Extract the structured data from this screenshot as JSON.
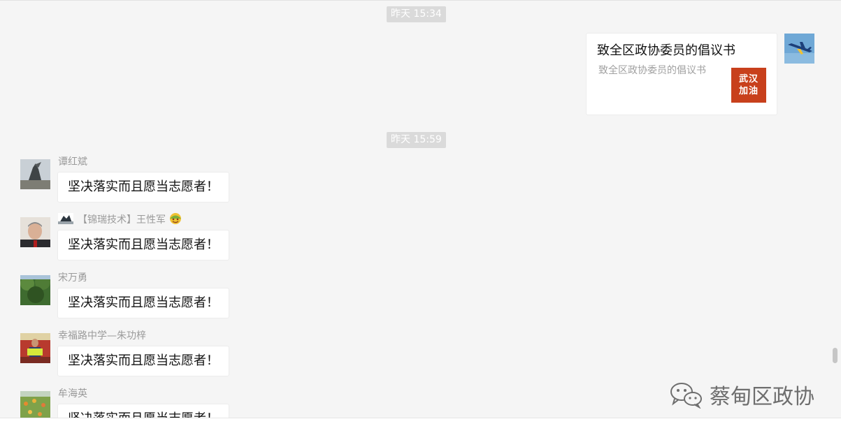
{
  "timestamps": [
    "昨天 15:34",
    "昨天 15:59"
  ],
  "share_card": {
    "title": "致全区政协委员的倡议书",
    "description": "致全区政协委员的倡议书",
    "thumb_line1": "武汉",
    "thumb_line2": "加油"
  },
  "messages": [
    {
      "sender": "谭红斌",
      "text": "坚决落实而且愿当志愿者！"
    },
    {
      "sender": "【锦瑞技术】王性军",
      "text": "坚决落实而且愿当志愿者！"
    },
    {
      "sender": "宋万勇",
      "text": "坚决落实而且愿当志愿者！"
    },
    {
      "sender": "幸福路中学—朱功梓",
      "text": "坚决落实而且愿当志愿者！"
    },
    {
      "sender": "牟海英",
      "text": "坚决落实而且愿当志愿者！"
    }
  ],
  "watermark": "蔡甸区政协",
  "colors": {
    "background": "#f5f5f5",
    "bubble": "#ffffff",
    "timestamp_bg": "#dadada",
    "thumb": "#c8401c"
  }
}
